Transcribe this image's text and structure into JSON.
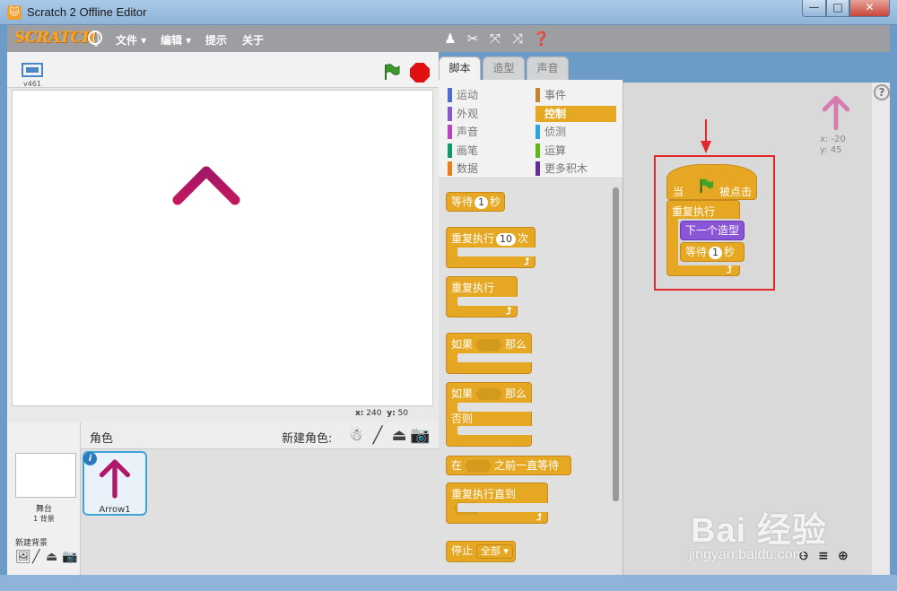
{
  "window": {
    "title": "Scratch 2 Offline Editor",
    "minimize": "—",
    "maximize": "□",
    "close": "✕"
  },
  "menubar": {
    "logo": "SCRATCH",
    "items": [
      "文件 ▾",
      "编辑 ▾",
      "提示",
      "关于"
    ],
    "tools": [
      "stamp-icon",
      "cut-icon",
      "grow-icon",
      "shrink-icon",
      "help-icon"
    ]
  },
  "stage": {
    "version": "v461",
    "mouse_x_label": "x:",
    "mouse_x": "240",
    "mouse_y_label": "y:",
    "mouse_y": "50",
    "sprite_color": "#c2185b"
  },
  "sprites": {
    "header": "角色",
    "new_sprite_label": "新建角色:",
    "stage_label": "舞台",
    "backdrop_count": "1 背景",
    "new_backdrop_label": "新建背景",
    "items": [
      {
        "name": "Arrow1",
        "info": "i"
      }
    ]
  },
  "tabs": [
    "脚本",
    "造型",
    "声音"
  ],
  "categories": [
    {
      "label": "运动",
      "color": "#4a6cd4"
    },
    {
      "label": "外观",
      "color": "#8a55d7"
    },
    {
      "label": "声音",
      "color": "#bb42c3"
    },
    {
      "label": "画笔",
      "color": "#0e9a6c"
    },
    {
      "label": "数据",
      "color": "#ee7d16"
    },
    {
      "label": "事件",
      "color": "#c88330"
    },
    {
      "label": "控制",
      "color": "#e6a822"
    },
    {
      "label": "侦测",
      "color": "#2ca5e2"
    },
    {
      "label": "运算",
      "color": "#5cb712"
    },
    {
      "label": "更多积木",
      "color": "#632d99"
    }
  ],
  "palette_blocks": {
    "wait": {
      "label": "等待",
      "value": "1",
      "unit": "秒"
    },
    "repeat": {
      "label": "重复执行",
      "value": "10",
      "unit": "次"
    },
    "forever": {
      "label": "重复执行"
    },
    "if_then": {
      "if": "如果",
      "then": "那么"
    },
    "if_else": {
      "if": "如果",
      "then": "那么",
      "else": "否则"
    },
    "wait_until": {
      "label": "在",
      "suffix": "之前一直等待"
    },
    "repeat_until": {
      "label": "重复执行直到"
    },
    "stop": {
      "label": "停止",
      "option": "全部"
    }
  },
  "script": {
    "hat_when": "当",
    "hat_clicked": "被点击",
    "forever": "重复执行",
    "next_costume": "下一个造型",
    "wait": "等待",
    "wait_value": "1",
    "wait_unit": "秒"
  },
  "selected_sprite": {
    "x_label": "x:",
    "x": "-20",
    "y_label": "y:",
    "y": "45"
  },
  "zoom": [
    "zoom-out-icon",
    "zoom-reset-icon",
    "zoom-in-icon"
  ],
  "watermark": {
    "big": "Bai 经验",
    "small": "jingyan.baidu.com"
  }
}
